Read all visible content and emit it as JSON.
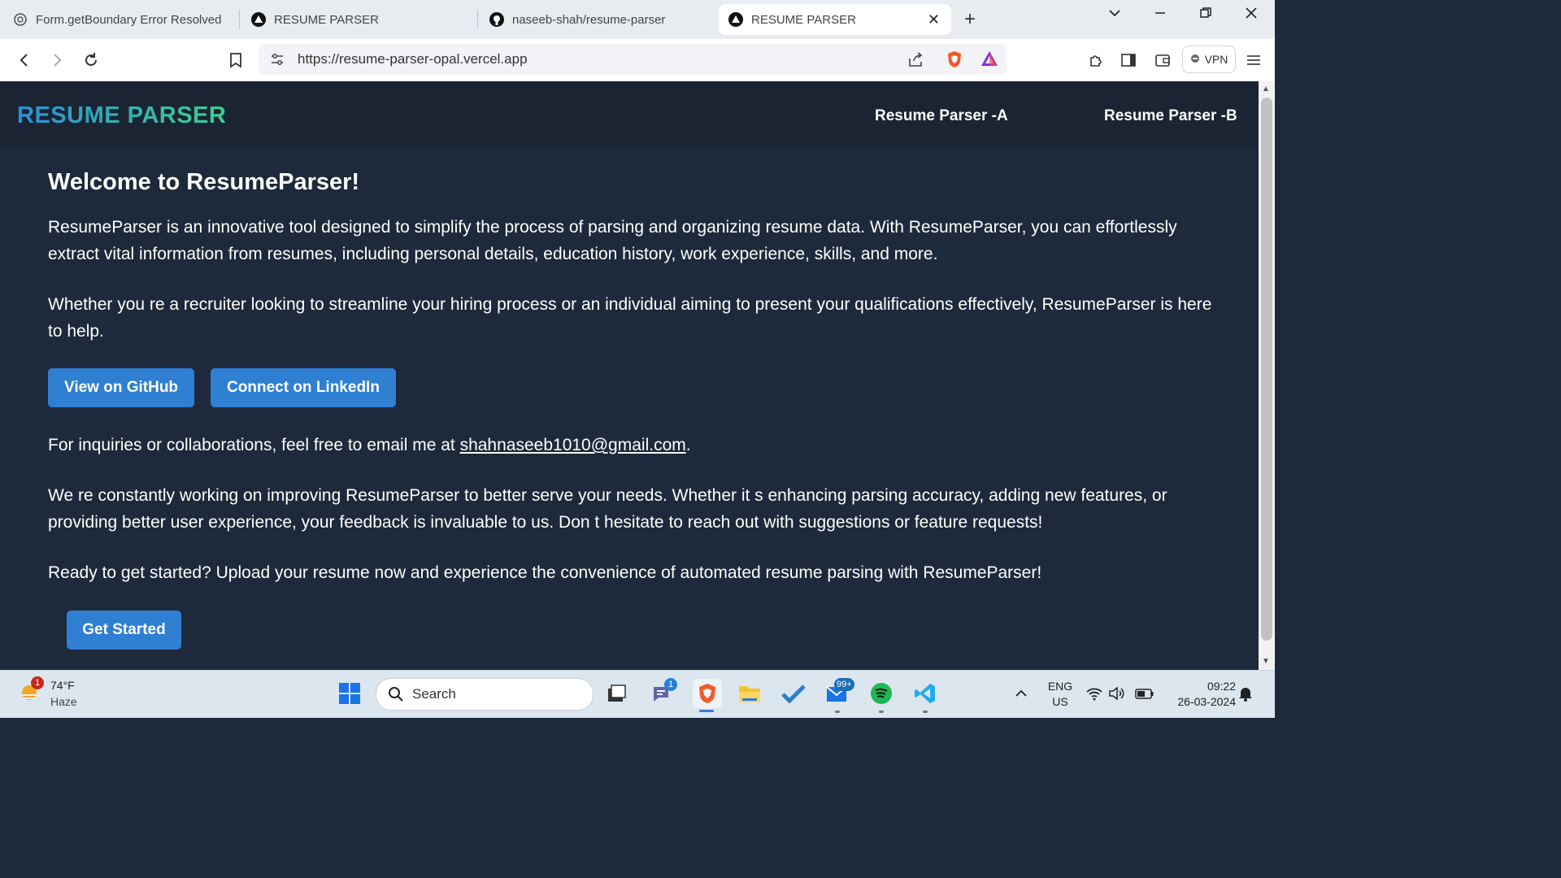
{
  "browser": {
    "tabs": [
      {
        "title": "Form.getBoundary Error Resolved",
        "icon": "chatgpt-icon"
      },
      {
        "title": "RESUME PARSER",
        "icon": "vercel-icon"
      },
      {
        "title": "naseeb-shah/resume-parser",
        "icon": "github-icon"
      },
      {
        "title": "RESUME PARSER",
        "icon": "vercel-icon",
        "active": true
      }
    ],
    "close_tab": "✕",
    "new_tab": "+",
    "url": "https://resume-parser-opal.vercel.app",
    "vpn_label": "VPN"
  },
  "site": {
    "brand": "RESUME PARSER",
    "nav": [
      "Resume Parser -A",
      "Resume Parser -B"
    ],
    "welcome": "Welcome to ResumeParser!",
    "intro": "ResumeParser is an innovative tool designed to simplify the process of parsing and organizing resume data. With ResumeParser, you can effortlessly extract vital information from resumes, including personal details, education history, work experience, skills, and more.",
    "audience": "Whether you re a recruiter looking to streamline your hiring process or an individual aiming to present your qualifications effectively, ResumeParser is here to help.",
    "github_button": "View on GitHub",
    "linkedin_button": "Connect on LinkedIn",
    "inquiry_prefix": "For inquiries or collaborations, feel free to email me at ",
    "email": "shahnaseeb1010@gmail.com",
    "inquiry_suffix": ".",
    "improving": "We re constantly working on improving ResumeParser to better serve your needs. Whether it s enhancing parsing accuracy, adding new features, or providing better user experience, your feedback is invaluable to us. Don t hesitate to reach out with suggestions or feature requests!",
    "ready": "Ready to get started? Upload your resume now and experience the convenience of automated resume parsing with ResumeParser!",
    "get_started": "Get Started"
  },
  "taskbar": {
    "weather_badge": "1",
    "temperature": "74°F",
    "condition": "Haze",
    "search_label": "Search",
    "teams_badge": "1",
    "mail_badge": "99+",
    "language": "ENG",
    "region": "US",
    "time": "09:22",
    "date": "26-03-2024"
  },
  "colors": {
    "page_bg": "#1e293b",
    "navbar_bg": "#1a2433",
    "button_blue": "#2f7fd2",
    "brand_gradient_start": "#2d8fd6",
    "brand_gradient_end": "#3ecf8e"
  }
}
